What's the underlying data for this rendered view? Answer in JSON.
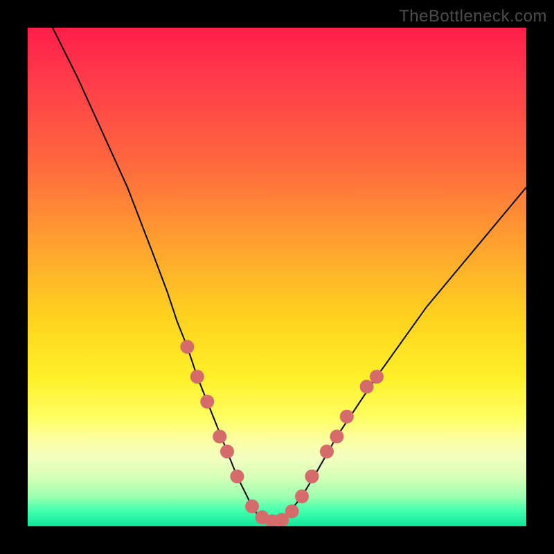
{
  "watermark": "TheBottleneck.com",
  "colors": {
    "frame": "#000000",
    "curve": "#000000",
    "dot": "#d66b6b"
  },
  "chart_data": {
    "type": "line",
    "title": "",
    "xlabel": "",
    "ylabel": "",
    "xlim": [
      0,
      100
    ],
    "ylim": [
      0,
      100
    ],
    "series": [
      {
        "name": "bottleneck-curve",
        "x": [
          5,
          10,
          15,
          20,
          25,
          28,
          30,
          32,
          34,
          36,
          38,
          40,
          42,
          44,
          45,
          46,
          47,
          48,
          49,
          50,
          51,
          52,
          53,
          55,
          58,
          62,
          66,
          70,
          75,
          80,
          85,
          90,
          95,
          100
        ],
        "y": [
          100,
          90,
          79,
          68,
          55,
          47,
          41,
          36,
          30,
          25,
          20,
          15,
          10,
          6,
          4,
          2.5,
          1.5,
          1,
          1,
          1,
          1.3,
          2,
          3.5,
          6,
          11,
          18,
          24,
          30,
          37,
          44,
          50,
          56,
          62,
          68
        ]
      }
    ],
    "scatter_points": {
      "name": "highlight-dots",
      "points": [
        {
          "x": 32,
          "y": 36
        },
        {
          "x": 34,
          "y": 30
        },
        {
          "x": 36,
          "y": 25
        },
        {
          "x": 38.5,
          "y": 18
        },
        {
          "x": 40,
          "y": 15
        },
        {
          "x": 42,
          "y": 10
        },
        {
          "x": 45,
          "y": 4
        },
        {
          "x": 47,
          "y": 1.8
        },
        {
          "x": 49,
          "y": 1
        },
        {
          "x": 51,
          "y": 1.3
        },
        {
          "x": 53,
          "y": 3
        },
        {
          "x": 55,
          "y": 6
        },
        {
          "x": 57,
          "y": 10
        },
        {
          "x": 60,
          "y": 15
        },
        {
          "x": 62,
          "y": 18
        },
        {
          "x": 64,
          "y": 22
        },
        {
          "x": 68,
          "y": 28
        },
        {
          "x": 70,
          "y": 30
        }
      ]
    }
  }
}
